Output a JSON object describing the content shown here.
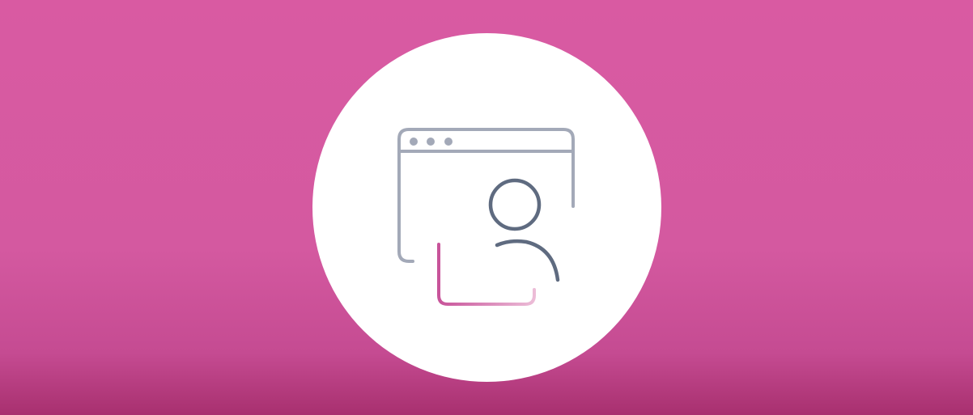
{
  "banner": {
    "colors": {
      "background_top": "#d95aa2",
      "background_bottom": "#a8306f",
      "badge": "#ffffff",
      "window_outline": "#a3a9b8",
      "person_outline": "#5f6b80",
      "accent_frame_start": "#c8549a",
      "accent_frame_end": "#ecbcd7"
    },
    "icons": {
      "badge": "white-circle-badge",
      "main": "browser-window-with-user-icon"
    }
  }
}
